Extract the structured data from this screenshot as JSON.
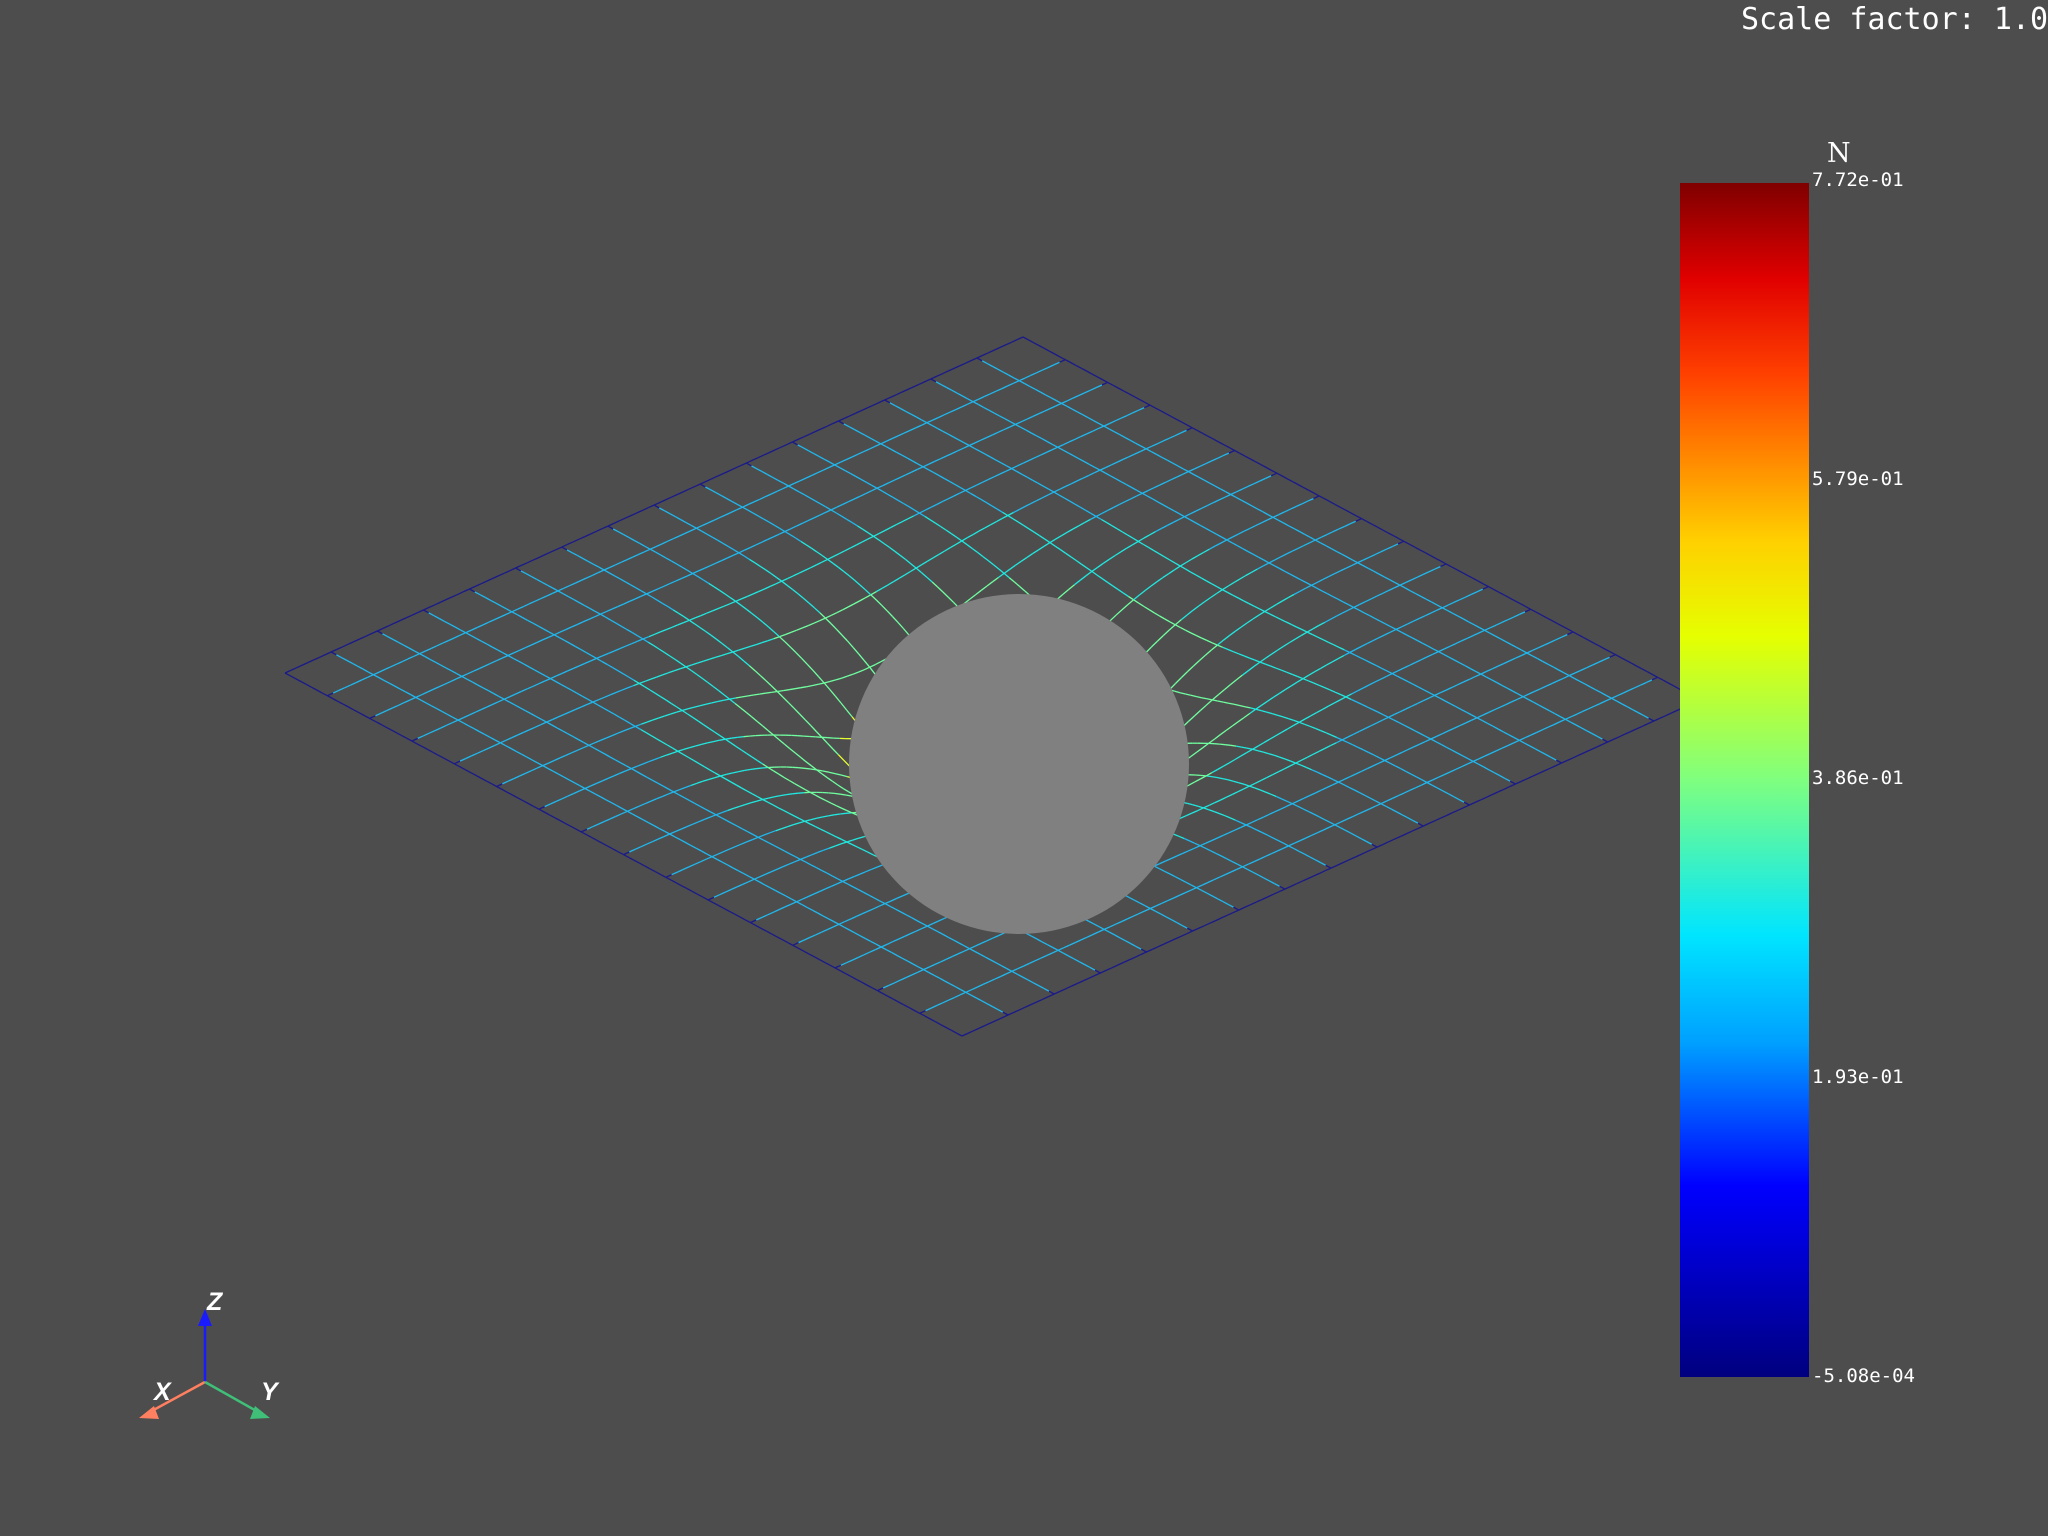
{
  "scale_factor_label": "Scale factor: 1.0",
  "colorbar": {
    "title": "N",
    "ticks": [
      "7.72e-01",
      "5.79e-01",
      "3.86e-01",
      "1.93e-01",
      "-5.08e-04"
    ],
    "colormap": "jet",
    "range": [
      -0.000508,
      0.772
    ]
  },
  "axes_triad": {
    "x_label": "X",
    "y_label": "Y",
    "z_label": "Z",
    "x_color": "#ff7f61",
    "y_color": "#3fbf78",
    "z_color": "#1a1aff"
  },
  "scene": {
    "background": "#4d4d4d",
    "sphere_color": "#808080",
    "mesh_style": "wireframe",
    "mesh_divisions": 16
  }
}
